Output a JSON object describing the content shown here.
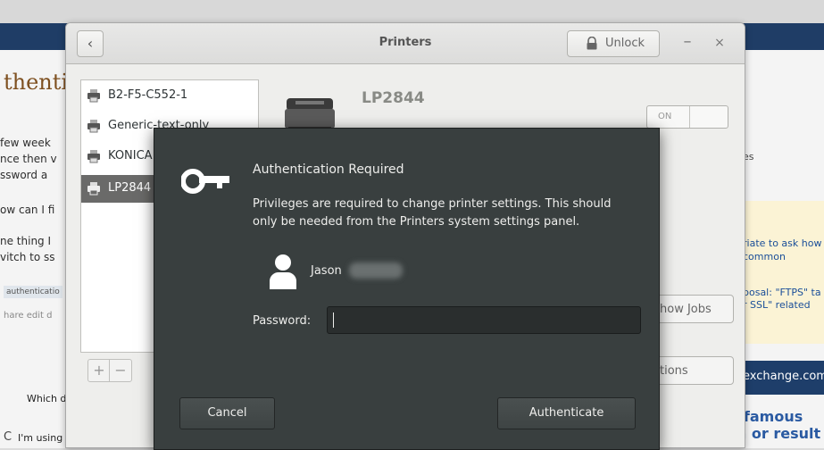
{
  "background_page": {
    "heading": "thentic",
    "left_lines": [
      "few week",
      "nce then v",
      "ssword a",
      "ow can I fi",
      "ne thing I",
      "vitch to ss"
    ],
    "tag": "authenticatio",
    "share": "hare  edit  d",
    "right_text": [
      "es",
      "riate to ask how t",
      "common",
      "posal: \"FTPS\" ta",
      "r SSL\" related"
    ],
    "right_bar": "exchange.com",
    "promo_line1": "What famous",
    "promo_line2": "theorem or result",
    "which": "Which d",
    "gnome": "I'm using Gnome and ye",
    "c_letter": "C"
  },
  "window": {
    "title": "Printers",
    "back_glyph": "‹",
    "unlock_label": "Unlock",
    "lock_glyph": "🔒",
    "minimize_glyph": "–",
    "close_glyph": "×"
  },
  "printers": [
    {
      "label": "B2-F5-C552-1",
      "selected": false
    },
    {
      "label": "Generic-text-only",
      "selected": false
    },
    {
      "label": "KONICA",
      "selected": false
    },
    {
      "label": "LP2844",
      "selected": true
    }
  ],
  "list_buttons": {
    "add": "+",
    "remove": "−"
  },
  "detail": {
    "printer_name": "LP2844",
    "switch_label": "ON",
    "show_jobs_label": "how Jobs",
    "options_label": "tions"
  },
  "dialog": {
    "title": "Authentication Required",
    "message": "Privileges are required to change printer settings. This should only be needed from the Printers system settings panel.",
    "user_name": "Jason",
    "password_label": "Password:",
    "password_value": "",
    "cancel_label": "Cancel",
    "authenticate_label": "Authenticate"
  },
  "colors": {
    "dialog_bg": "#393f3f",
    "selected_row": "#6a6a69",
    "nav_bar": "#1f3d66"
  }
}
